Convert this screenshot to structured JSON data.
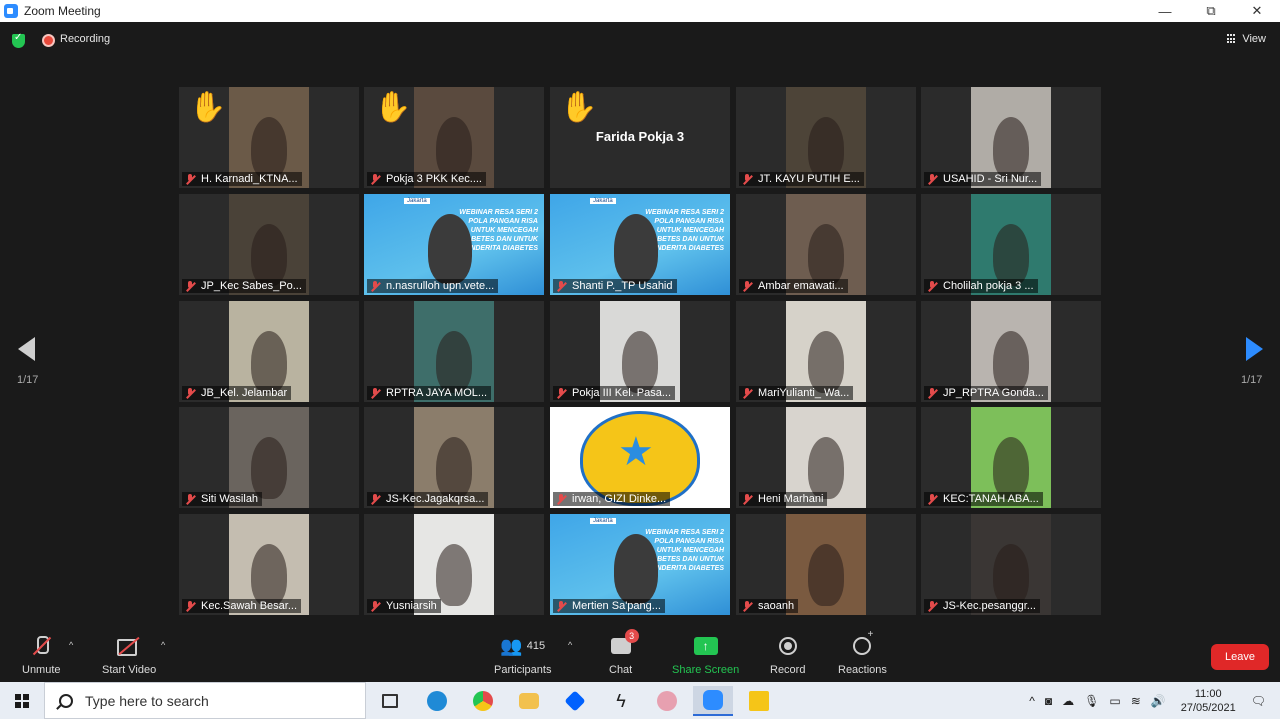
{
  "window": {
    "title": "Zoom Meeting",
    "minimize": "—",
    "maximize": "⧉",
    "close": "✕"
  },
  "topbar": {
    "recording_label": "Recording",
    "view_label": "View"
  },
  "pager": {
    "left_indicator": "1/17",
    "right_indicator": "1/17"
  },
  "tiles": [
    {
      "name": "H. Karnadi_KTNA...",
      "hand": true,
      "bg": "#6b5a48"
    },
    {
      "name": "Pokja 3 PKK Kec....",
      "hand": true,
      "bg": "#5a4a3e"
    },
    {
      "name": "",
      "hand": true,
      "center_name": "Farida Pokja 3",
      "bg": "#2b2b2b"
    },
    {
      "name": "JT. KAYU PUTIH E...",
      "hand": false,
      "bg": "#4d4438"
    },
    {
      "name": "USAHID - Sri Nur...",
      "hand": false,
      "bg": "#b0aca6"
    },
    {
      "name": "JP_Kec Sabes_Po...",
      "hand": false,
      "bg": "#4a4238"
    },
    {
      "name": "n.nasrulloh upn.vete...",
      "hand": false,
      "bg": "#4aaee8",
      "active": true,
      "slide": true
    },
    {
      "name": "Shanti P._TP Usahid",
      "hand": false,
      "bg": "#4aaee8",
      "slide": true
    },
    {
      "name": "Ambar emawati...",
      "hand": false,
      "bg": "#6e5d50"
    },
    {
      "name": "Cholilah pokja 3 ...",
      "hand": false,
      "bg": "#2f7a6e"
    },
    {
      "name": "JB_Kel. Jelambar",
      "hand": false,
      "bg": "#b9b3a0"
    },
    {
      "name": "RPTRA JAYA MOL...",
      "hand": false,
      "bg": "#3e6e6a"
    },
    {
      "name": "Pokja III Kel. Pasa...",
      "hand": false,
      "bg": "#d9d9d7"
    },
    {
      "name": "MariYulianti_ Wa...",
      "hand": false,
      "bg": "#d6d2c9"
    },
    {
      "name": "JP_RPTRA Gonda...",
      "hand": false,
      "bg": "#b9b4af"
    },
    {
      "name": "Siti Wasilah",
      "hand": false,
      "bg": "#6a645e"
    },
    {
      "name": "JS-Kec.Jagakqrsa...",
      "hand": false,
      "bg": "#8b7d6b"
    },
    {
      "name": "irwan, GIZI Dinke...",
      "hand": false,
      "bg": "#ffffff",
      "logo": true
    },
    {
      "name": "Heni Marhani",
      "hand": false,
      "bg": "#d8d4ce"
    },
    {
      "name": "KEC:TANAH ABA...",
      "hand": false,
      "bg": "#7dbf5a"
    },
    {
      "name": "Kec.Sawah Besar...",
      "hand": false,
      "bg": "#c4bdb0"
    },
    {
      "name": "Yusniarsih",
      "hand": false,
      "bg": "#e6e6e4"
    },
    {
      "name": "Mertien Sa'pang...",
      "hand": false,
      "bg": "#4aaee8",
      "slide": true
    },
    {
      "name": "saoanh",
      "hand": false,
      "bg": "#7a5a40"
    },
    {
      "name": "JS-Kec.pesanggr...",
      "hand": false,
      "bg": "#3a3634"
    }
  ],
  "slide": {
    "header": "Jakarta",
    "text": "WEBINAR RESA SERI 2 POLA PANGAN RISA UNTUK MENCEGAH DIABETES DAN UNTUK PENDERITA DIABETES"
  },
  "toolbar": {
    "unmute": "Unmute",
    "start_video": "Start Video",
    "participants": "Participants",
    "participant_count": "415",
    "chat": "Chat",
    "chat_badge": "3",
    "share_screen": "Share Screen",
    "record": "Record",
    "reactions": "Reactions",
    "leave": "Leave"
  },
  "taskbar": {
    "search_placeholder": "Type here to search",
    "time": "11:00",
    "date": "27/05/2021"
  },
  "colors": {
    "accent_blue": "#2d8cff",
    "share_green": "#23c552",
    "leave_red": "#e02828",
    "mute_red": "#e34b4b"
  }
}
